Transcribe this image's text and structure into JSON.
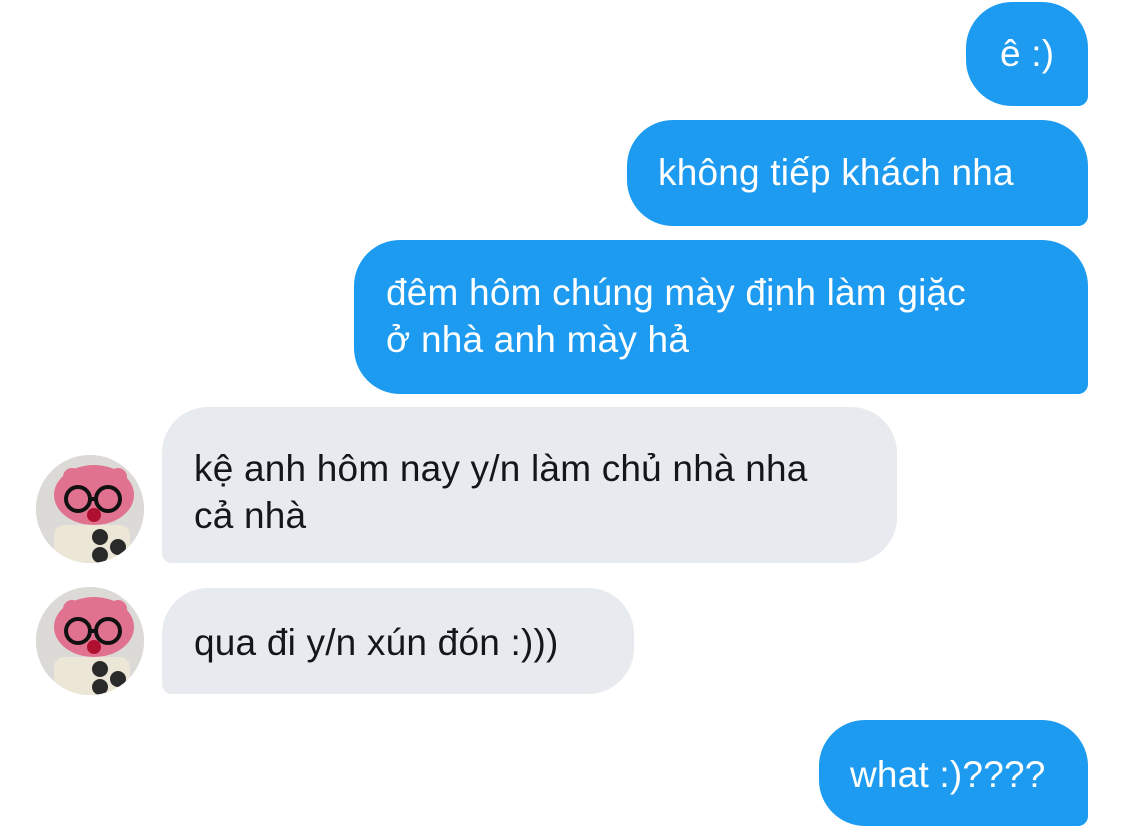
{
  "conversation": {
    "messages": [
      {
        "sender": "me",
        "text": "ê :)"
      },
      {
        "sender": "me",
        "text": "không tiếp khách nha"
      },
      {
        "sender": "me",
        "text": "đêm hôm chúng mày định làm giặc\nở nhà anh mày hả"
      },
      {
        "sender": "other",
        "text": "kệ anh hôm nay y/n làm chủ nhà nha\ncả nhà"
      },
      {
        "sender": "other",
        "text": "qua đi y/n xún đón :)))"
      },
      {
        "sender": "me",
        "text": "what :)????"
      }
    ]
  },
  "colors": {
    "outgoing_bubble": "#1d9bf0",
    "incoming_bubble": "#e7eaee",
    "outgoing_text": "#ffffff",
    "incoming_text": "#14171a"
  },
  "icons": {
    "avatar": "pink-plush-with-glasses-avatar"
  }
}
